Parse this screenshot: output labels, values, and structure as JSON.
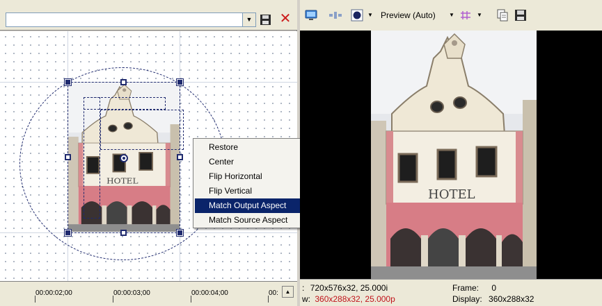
{
  "left_toolbar": {
    "preset_value": ""
  },
  "context_menu": {
    "items": [
      {
        "label": "Restore",
        "selected": false
      },
      {
        "label": "Center",
        "selected": false
      },
      {
        "label": "Flip Horizontal",
        "selected": false
      },
      {
        "label": "Flip Vertical",
        "selected": false
      },
      {
        "label": "Match Output Aspect",
        "selected": true
      },
      {
        "label": "Match Source Aspect",
        "selected": false
      }
    ]
  },
  "timeline": {
    "ticks": [
      "00:00:02;00",
      "00:00:03;00",
      "00:00:04;00",
      "00:"
    ]
  },
  "preview_toolbar": {
    "preview_mode": "Preview (Auto)"
  },
  "status": {
    "project_label": ":",
    "project_value": "720x576x32, 25.000i",
    "preview_label": "w:",
    "preview_value": "360x288x32, 25.000p",
    "frame_label": "Frame:",
    "frame_value": "0",
    "display_label": "Display:",
    "display_value": "360x288x32"
  },
  "colors": {
    "selection": "#0a246a",
    "handles": "#1f2a6e",
    "delete_red": "#cc1b1b",
    "status_red": "#c0131a",
    "preview_bg": "#000000"
  },
  "icons": {
    "save": "save-icon",
    "delete": "close-icon",
    "preview_monitor": "monitor-icon",
    "split": "split-screen-icon",
    "overlays": "overlay-icon",
    "grid": "grid-icon",
    "copy_snapshot": "copy-snapshot-icon",
    "save_snapshot": "save-snapshot-icon"
  }
}
